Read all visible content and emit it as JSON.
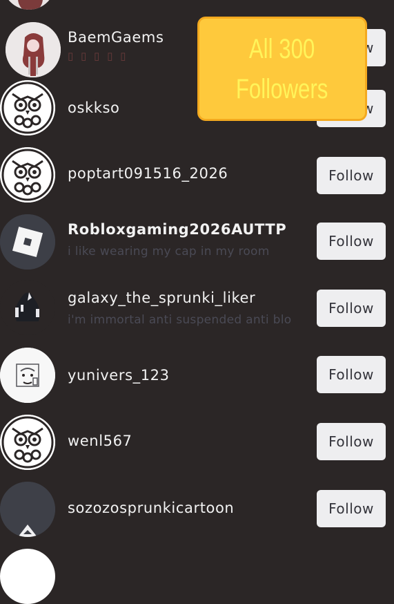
{
  "callout": {
    "text": "All 300\nFollowers"
  },
  "followers": [
    {
      "username": "BaemGaems",
      "bio": "",
      "button": "Follow",
      "avatar": "girl-avatar"
    },
    {
      "username": "oskkso",
      "bio": "",
      "button": "Follow",
      "avatar": "owl-avatar"
    },
    {
      "username": "poptart091516_2026",
      "bio": "",
      "button": "Follow",
      "avatar": "owl-avatar"
    },
    {
      "username": "Robloxgaming2026AUTTP",
      "bio": "i like wearing my cap in my room",
      "button": "Follow",
      "avatar": "roblox-logo-avatar"
    },
    {
      "username": "galaxy_the_sprunki_liker",
      "bio": "i'm immortal anti suspended anti blo",
      "button": "Follow",
      "avatar": "dark-figure-avatar"
    },
    {
      "username": "yunivers_123",
      "bio": "",
      "button": "Follow",
      "avatar": "sketch-avatar"
    },
    {
      "username": "wenl567",
      "bio": "",
      "button": "Follow",
      "avatar": "owl-avatar"
    },
    {
      "username": "sozozosprunkicartoon",
      "bio": "",
      "button": "Follow",
      "avatar": "dark-figure-avatar"
    }
  ]
}
